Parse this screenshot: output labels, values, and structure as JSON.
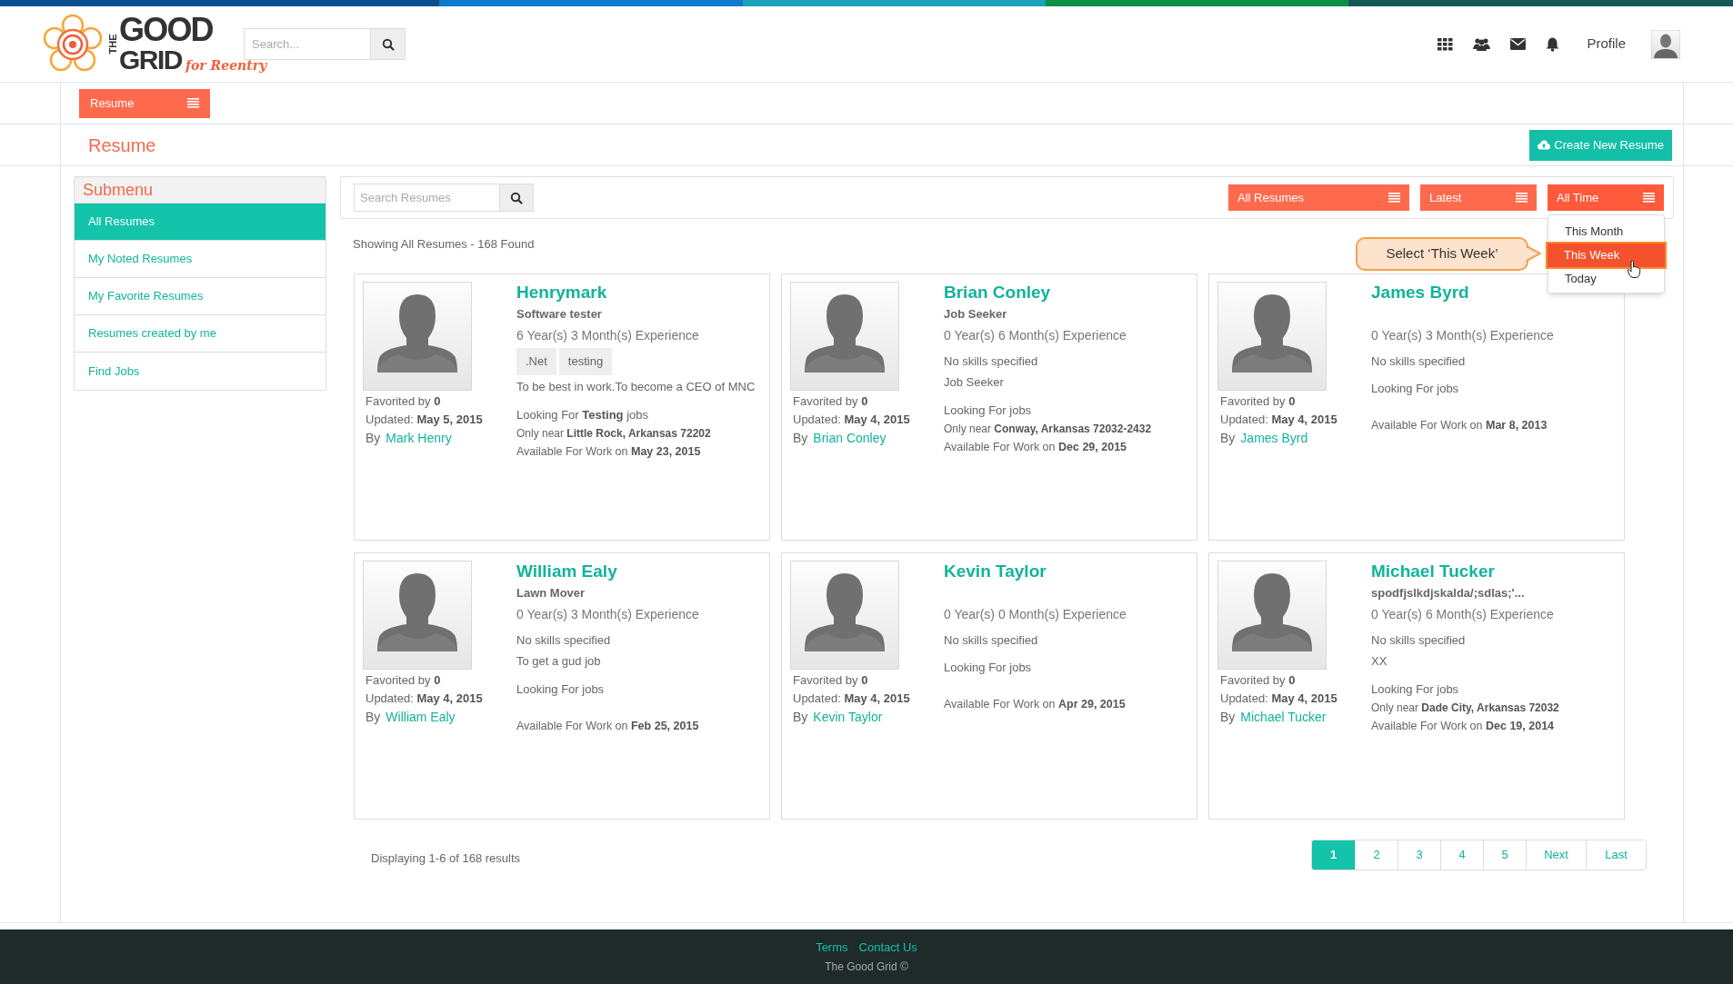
{
  "logo": {
    "top": "THE",
    "word1": "GOOD",
    "word2": "GRID",
    "tagline": "for Reentry"
  },
  "header": {
    "search": {
      "placeholder": "Search..."
    },
    "profile_label": "Profile"
  },
  "section_menu": {
    "label": "Resume"
  },
  "page_title": "Resume",
  "create_button": {
    "label": "Create New Resume"
  },
  "sidebar": {
    "title": "Submenu",
    "items": [
      {
        "label": "All Resumes",
        "selected": true
      },
      {
        "label": "My Noted Resumes",
        "selected": false
      },
      {
        "label": "My Favorite Resumes",
        "selected": false
      },
      {
        "label": "Resumes created by me",
        "selected": false
      },
      {
        "label": "Find Jobs",
        "selected": false
      }
    ]
  },
  "search": {
    "placeholder": "Search Resumes"
  },
  "filters": [
    {
      "label": "All Resumes",
      "expanded": false
    },
    {
      "label": "Latest",
      "expanded": false
    },
    {
      "label": "All Time",
      "expanded": true
    }
  ],
  "dropdown": {
    "items": [
      {
        "label": "This Month",
        "selected": false
      },
      {
        "label": "This Week",
        "selected": true
      },
      {
        "label": "Today",
        "selected": false
      }
    ]
  },
  "callout": "Select ‘This Week’",
  "summary": "Showing All Resumes - 168 Found",
  "resumes": [
    {
      "name": "Henrymark",
      "headline": "Software tester",
      "experience": "6 Year(s) 3 Month(s) Experience",
      "skills": [
        ".Net",
        "testing"
      ],
      "objective": "To be best in work.To become a CEO of MNC",
      "looking_for": "Looking For **Testing** jobs",
      "near": "Only near **Little Rock, Arkansas 72202**",
      "available": "Available For Work on **May 23, 2015**",
      "favorited": "Favorited by **0**",
      "updated": "Updated: **May 5, 2015**",
      "by_label": "By",
      "author": "Mark Henry"
    },
    {
      "name": "Brian Conley",
      "headline": "Job Seeker",
      "experience": "0 Year(s) 6 Month(s) Experience",
      "skills_note": "No skills specified",
      "objective": "Job Seeker",
      "looking_for": "Looking For jobs",
      "near": "Only near **Conway, Arkansas 72032-2432**",
      "available": "Available For Work on **Dec 29, 2015**",
      "favorited": "Favorited by **0**",
      "updated": "Updated: **May 4, 2015**",
      "by_label": "By",
      "author": "Brian Conley"
    },
    {
      "name": "James Byrd",
      "experience": "0 Year(s) 3 Month(s) Experience",
      "skills_note": "No skills specified",
      "looking_for": "Looking For jobs",
      "available": "Available For Work on **Mar 8, 2013**",
      "favorited": "Favorited by **0**",
      "updated": "Updated: **May 4, 2015**",
      "by_label": "By",
      "author": "James Byrd"
    },
    {
      "name": "William Ealy",
      "headline": "Lawn Mover",
      "experience": "0 Year(s) 3 Month(s) Experience",
      "skills_note": "No skills specified",
      "objective": "To get a gud job",
      "looking_for": "Looking For jobs",
      "available": "Available For Work on **Feb 25, 2015**",
      "favorited": "Favorited by **0**",
      "updated": "Updated: **May 4, 2015**",
      "by_label": "By",
      "author": "William Ealy"
    },
    {
      "name": "Kevin Taylor",
      "experience": "0 Year(s) 0 Month(s) Experience",
      "skills_note": "No skills specified",
      "looking_for": "Looking For jobs",
      "available": "Available For Work on **Apr 29, 2015**",
      "favorited": "Favorited by **0**",
      "updated": "Updated: **May 4, 2015**",
      "by_label": "By",
      "author": "Kevin Taylor"
    },
    {
      "name": "Michael Tucker",
      "headline": "spodfjslkdjskalda/;sdlas;'...",
      "experience": "0 Year(s) 6 Month(s) Experience",
      "skills_note": "No skills specified",
      "objective": "XX",
      "looking_for": "Looking For jobs",
      "near": "Only near **Dade City, Arkansas 72032**",
      "available": "Available For Work on **Dec 19, 2014**",
      "favorited": "Favorited by **0**",
      "updated": "Updated: **May 4, 2015**",
      "by_label": "By",
      "author": "Michael Tucker"
    }
  ],
  "results_text": "Displaying 1-6 of 168 results",
  "pagination": [
    {
      "label": "1",
      "selected": true
    },
    {
      "label": "2",
      "selected": false
    },
    {
      "label": "3",
      "selected": false
    },
    {
      "label": "4",
      "selected": false
    },
    {
      "label": "5",
      "selected": false
    },
    {
      "label": "Next",
      "selected": false
    },
    {
      "label": "Last",
      "selected": false
    }
  ],
  "footer": {
    "links": [
      "Terms",
      "Contact Us"
    ],
    "copyright": "The Good Grid ©"
  }
}
